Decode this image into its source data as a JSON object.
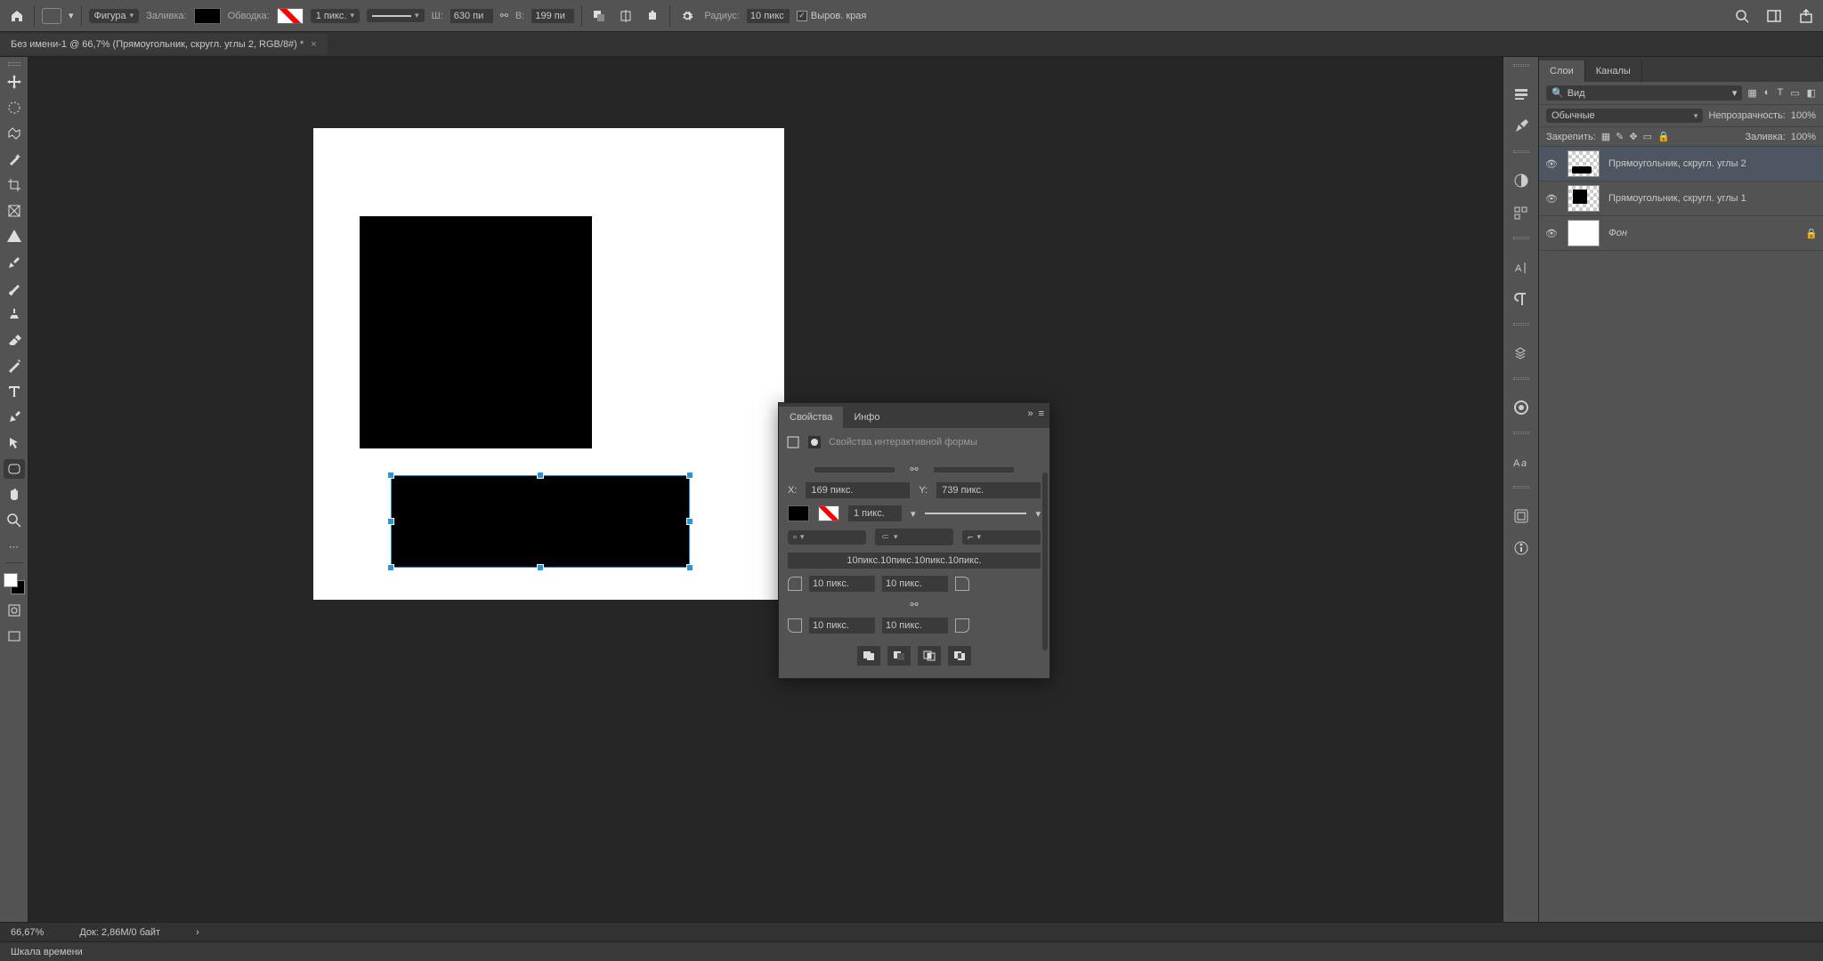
{
  "options": {
    "shape_mode": "Фигура",
    "fill_label": "Заливка:",
    "stroke_label": "Обводка:",
    "stroke_width": "1 пикс.",
    "w_label": "Ш:",
    "w_value": "630 пи",
    "h_label": "В:",
    "h_value": "199 пи",
    "radius_label": "Радиус:",
    "radius_value": "10 пикс",
    "align_edges": "Выров. края"
  },
  "tab": {
    "title": "Без имени-1 @ 66,7% (Прямоугольник, скругл. углы 2, RGB/8#) *"
  },
  "properties": {
    "tab_props": "Свойства",
    "tab_info": "Инфо",
    "header": "Свойства интерактивной формы",
    "x_label": "X:",
    "x_value": "169 пикс.",
    "y_label": "Y:",
    "y_value": "739 пикс.",
    "stroke_w": "1 пикс.",
    "radii_summary": "10пикс.10пикс.10пикс.10пикс.",
    "r_tl": "10 пикс.",
    "r_tr": "10 пикс.",
    "r_bl": "10 пикс.",
    "r_br": "10 пикс."
  },
  "layers": {
    "tab_layers": "Слои",
    "tab_channels": "Каналы",
    "search_kind": "Вид",
    "blend_mode": "Обычные",
    "opacity_label": "Непрозрачность:",
    "opacity_value": "100%",
    "lock_label": "Закрепить:",
    "fill_label": "Заливка:",
    "fill_value": "100%",
    "items": [
      {
        "name": "Прямоугольник, скругл. углы 2"
      },
      {
        "name": "Прямоугольник, скругл. углы 1"
      },
      {
        "name": "Фон"
      }
    ]
  },
  "status": {
    "zoom": "66,67%",
    "doc_size": "Док: 2,86M/0 байт"
  },
  "timeline": {
    "label": "Шкала времени"
  }
}
